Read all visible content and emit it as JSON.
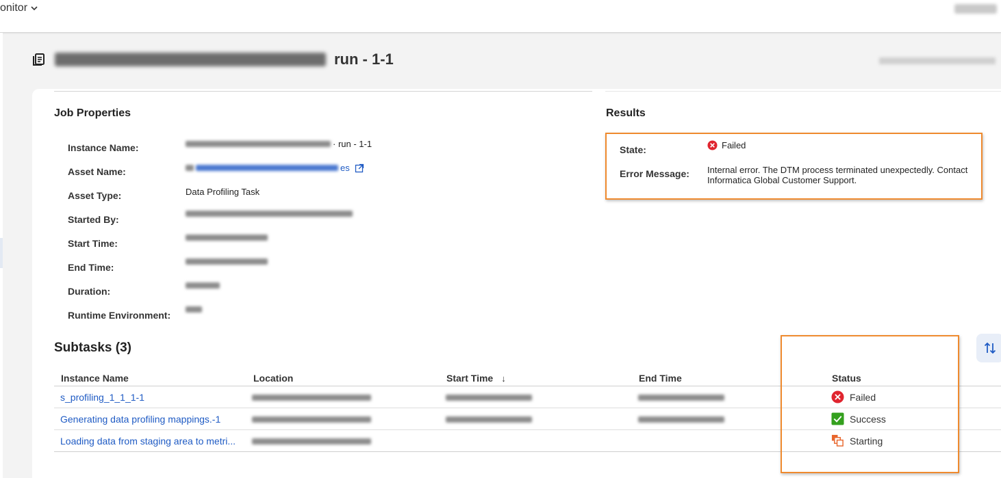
{
  "topbar": {
    "app_name": "onitor"
  },
  "header": {
    "run_label": "run - 1-1"
  },
  "job_properties": {
    "title": "Job Properties",
    "instance_name": {
      "label": "Instance Name:",
      "suffix": "· run - 1-1"
    },
    "asset_name": {
      "label": "Asset Name:",
      "suffix": "es"
    },
    "asset_type": {
      "label": "Asset Type:",
      "value": "Data Profiling Task"
    },
    "started_by": {
      "label": "Started By:"
    },
    "start_time": {
      "label": "Start Time:"
    },
    "end_time": {
      "label": "End Time:"
    },
    "duration": {
      "label": "Duration:"
    },
    "runtime_environment": {
      "label": "Runtime Environment:"
    }
  },
  "results": {
    "title": "Results",
    "state_label": "State:",
    "state_value": "Failed",
    "error_label": "Error Message:",
    "error_line1": "Internal error. The DTM process terminated unexpectedly. Contact",
    "error_line2": "Informatica Global Customer Support."
  },
  "subtasks": {
    "title": "Subtasks (3)",
    "columns": {
      "instance_name": "Instance Name",
      "location": "Location",
      "start_time": "Start Time",
      "end_time": "End Time",
      "status": "Status"
    },
    "sort_indicator": "↓",
    "rows": [
      {
        "name": "s_profiling_1_1_1-1",
        "status": "Failed",
        "status_icon": "error-icon"
      },
      {
        "name": "Generating data profiling mappings.-1",
        "status": "Success",
        "status_icon": "check-icon"
      },
      {
        "name": "Loading data from staging area to metri...",
        "status": "Starting",
        "status_icon": "starting-icon"
      }
    ]
  },
  "colors": {
    "accent": "#1f5bc4",
    "error": "#e0252f",
    "success": "#34a01e",
    "starting": "#e8662c",
    "highlight": "#ef8a2e"
  }
}
